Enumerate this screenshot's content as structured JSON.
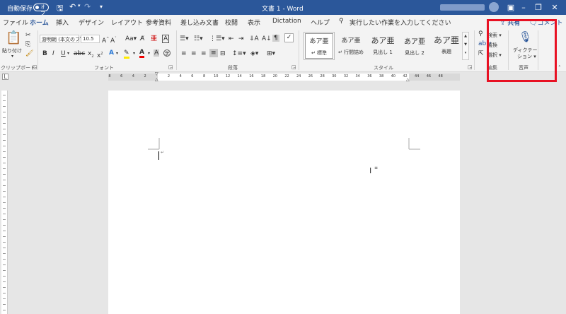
{
  "titlebar": {
    "autosave_label": "自動保存",
    "autosave_state": "オフ",
    "document_title": "文書 1 - Word"
  },
  "tabs": [
    {
      "label": "ファイル"
    },
    {
      "label": "ホーム"
    },
    {
      "label": "挿入"
    },
    {
      "label": "デザイン"
    },
    {
      "label": "レイアウト"
    },
    {
      "label": "参考資料"
    },
    {
      "label": "差し込み文書"
    },
    {
      "label": "校閲"
    },
    {
      "label": "表示"
    },
    {
      "label": "Dictation"
    },
    {
      "label": "ヘルプ"
    }
  ],
  "tellme_placeholder": "実行したい作業を入力してください",
  "share_label": "共有",
  "comment_label": "コメント",
  "clipboard": {
    "paste": "貼り付け",
    "group": "クリップボード"
  },
  "font": {
    "name": "游明朝 (本文のフ",
    "size": "10.5",
    "group": "フォント"
  },
  "paragraph": {
    "group": "段落"
  },
  "styles": {
    "group": "スタイル",
    "items": [
      {
        "sample": "あア亜",
        "name": "標準"
      },
      {
        "sample": "あア亜",
        "name": "行間詰め"
      },
      {
        "sample": "あア亜",
        "name": "見出し 1"
      },
      {
        "sample": "あア亜",
        "name": "見出し 2"
      },
      {
        "sample": "あア亜",
        "name": "表題"
      }
    ]
  },
  "editing": {
    "find": "検索",
    "replace": "置換",
    "select": "選択",
    "group": "編集"
  },
  "voice": {
    "dictation_line1": "ディクテー",
    "dictation_line2": "ション",
    "group": "音声"
  },
  "ruler_numbers": [
    "8",
    "6",
    "4",
    "2",
    "",
    "2",
    "4",
    "6",
    "8",
    "10",
    "12",
    "14",
    "16",
    "18",
    "20",
    "22",
    "24",
    "26",
    "28",
    "30",
    "32",
    "34",
    "36",
    "38",
    "40",
    "42",
    "44",
    "46",
    "48"
  ],
  "colors": {
    "accent": "#2b579a",
    "highlight": "#e81123"
  }
}
